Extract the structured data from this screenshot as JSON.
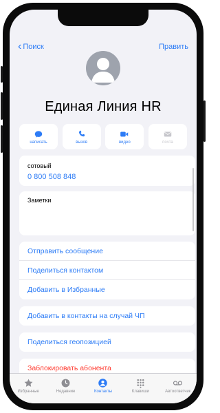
{
  "nav": {
    "back_label": "Поиск",
    "edit_label": "Править"
  },
  "contact": {
    "name": "Единая Линия HR"
  },
  "actions": [
    {
      "label": "написать",
      "icon": "message-icon",
      "enabled": true
    },
    {
      "label": "вызов",
      "icon": "phone-icon",
      "enabled": true
    },
    {
      "label": "видео",
      "icon": "video-icon",
      "enabled": true
    },
    {
      "label": "почта",
      "icon": "mail-icon",
      "enabled": false
    }
  ],
  "phone": {
    "label": "сотовый",
    "number": "0 800 508 848"
  },
  "notes": {
    "label": "Заметки"
  },
  "links": {
    "group1": [
      "Отправить сообщение",
      "Поделиться контактом",
      "Добавить в Избранные"
    ],
    "group2": "Добавить в контакты на случай ЧП",
    "group3": "Поделиться геопозицией",
    "group4": "Заблокировать абонента"
  },
  "tabs": [
    {
      "label": "Избранные",
      "icon": "star-icon",
      "active": false
    },
    {
      "label": "Недавние",
      "icon": "clock-icon",
      "active": false
    },
    {
      "label": "Контакты",
      "icon": "contacts-icon",
      "active": true
    },
    {
      "label": "Клавиши",
      "icon": "keypad-icon",
      "active": false
    },
    {
      "label": "Автоответчик",
      "icon": "voicemail-icon",
      "active": false
    }
  ],
  "colors": {
    "accent": "#2d7cf6",
    "danger": "#ff3b30",
    "background": "#f2f2f7",
    "frame": "#0b0b0b"
  }
}
